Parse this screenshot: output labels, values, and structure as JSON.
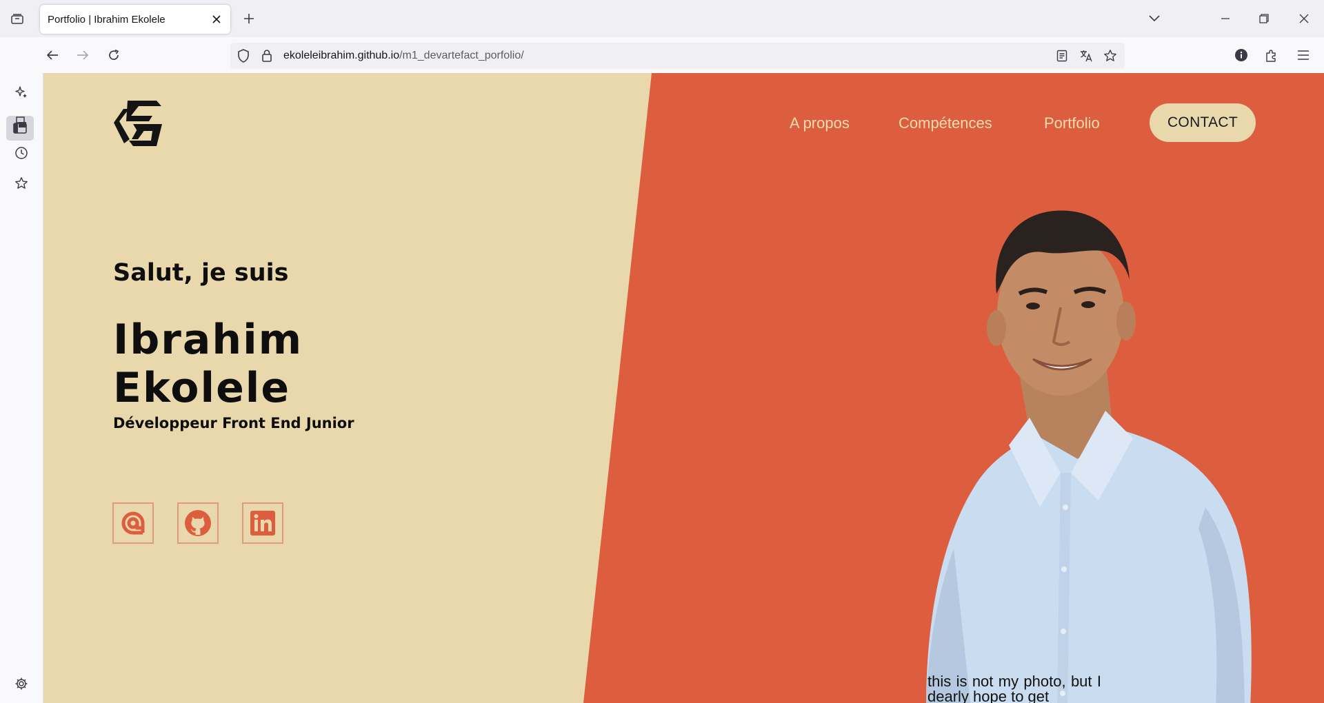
{
  "browser": {
    "tab_title": "Portfolio | Ibrahim Ekolele",
    "url_host": "ekoleleibrahim.github.io",
    "url_path": "/m1_devartefact_porfolio/"
  },
  "site": {
    "nav": {
      "links": [
        "A propos",
        "Compétences",
        "Portfolio"
      ],
      "contact_label": "CONTACT"
    },
    "hero": {
      "greeting": "Salut, je suis",
      "first_name": "Ibrahim",
      "last_name": "Ekolele",
      "role": "Développeur Front End Junior"
    },
    "social_icons": [
      "email-icon",
      "github-icon",
      "linkedin-icon"
    ],
    "caption": "this is not my photo, but I dearly hope to get"
  },
  "colors": {
    "beige": "#e9d8ab",
    "orange": "#dd5e3e",
    "nav_text": "#f2dcb0",
    "social_border": "#e09a80"
  }
}
